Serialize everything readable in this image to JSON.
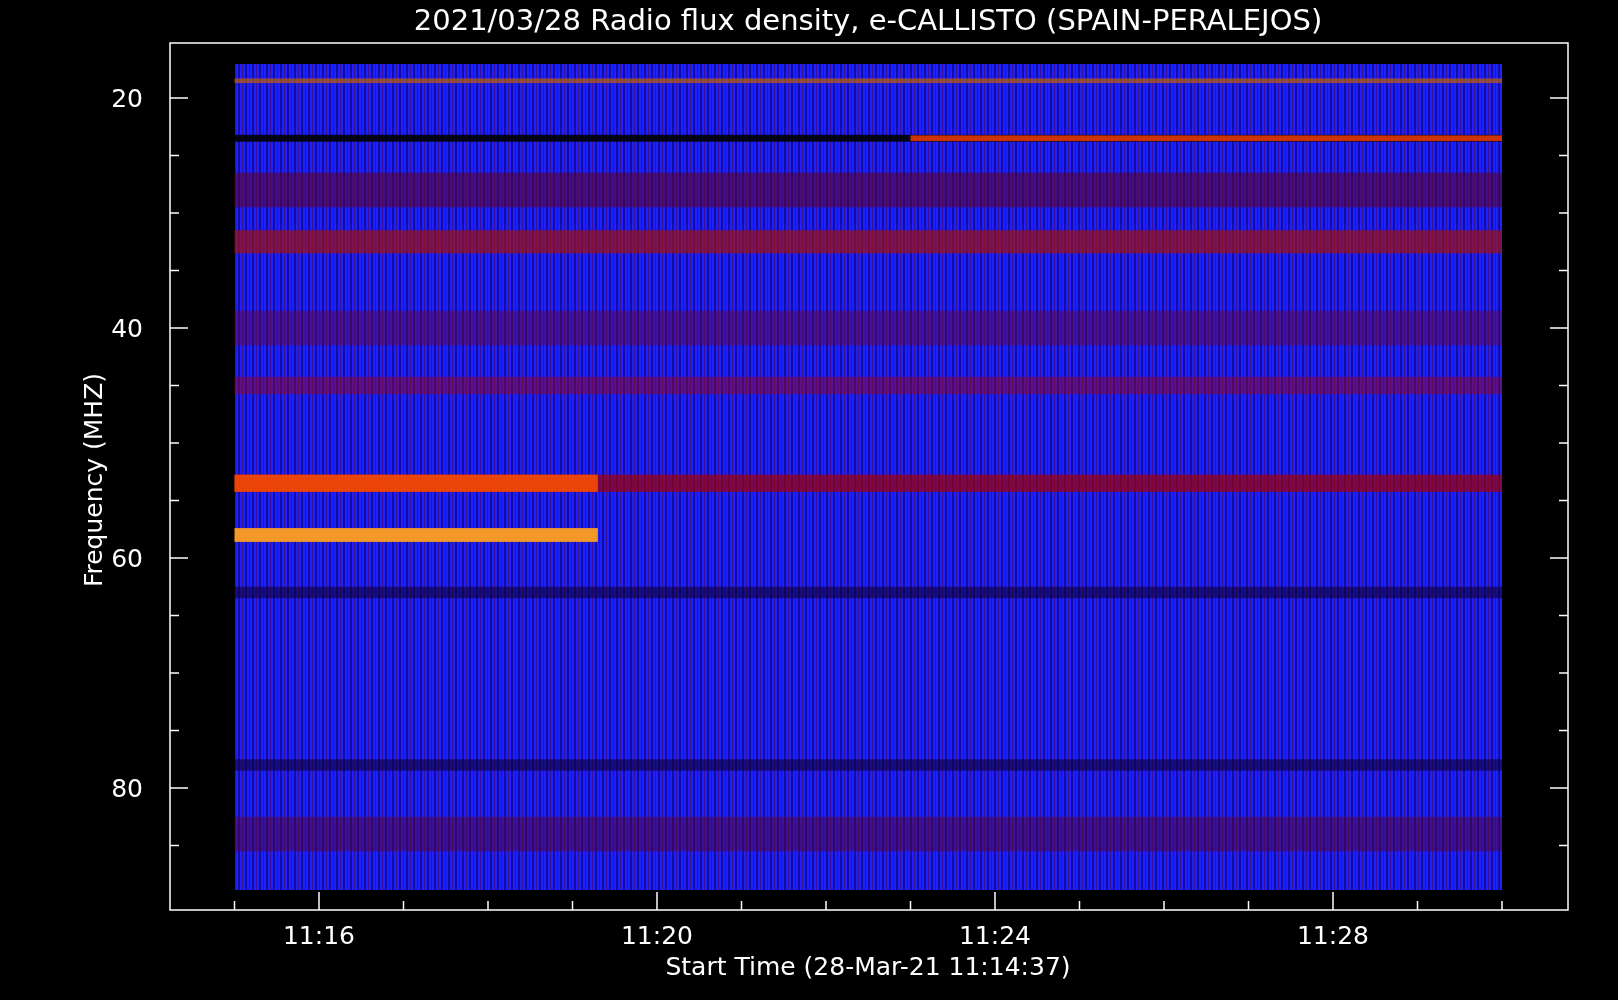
{
  "title": "2021/03/28  Radio flux density, e-CALLISTO (SPAIN-PERALEJOS)",
  "y_axis": {
    "label": "Frequency (MHZ)",
    "ticks": [
      "20",
      "40",
      "60",
      "80"
    ]
  },
  "x_axis": {
    "label": "Start Time (28-Mar-21 11:14:37)",
    "ticks": [
      "11:16",
      "11:20",
      "11:24",
      "11:28"
    ]
  }
}
